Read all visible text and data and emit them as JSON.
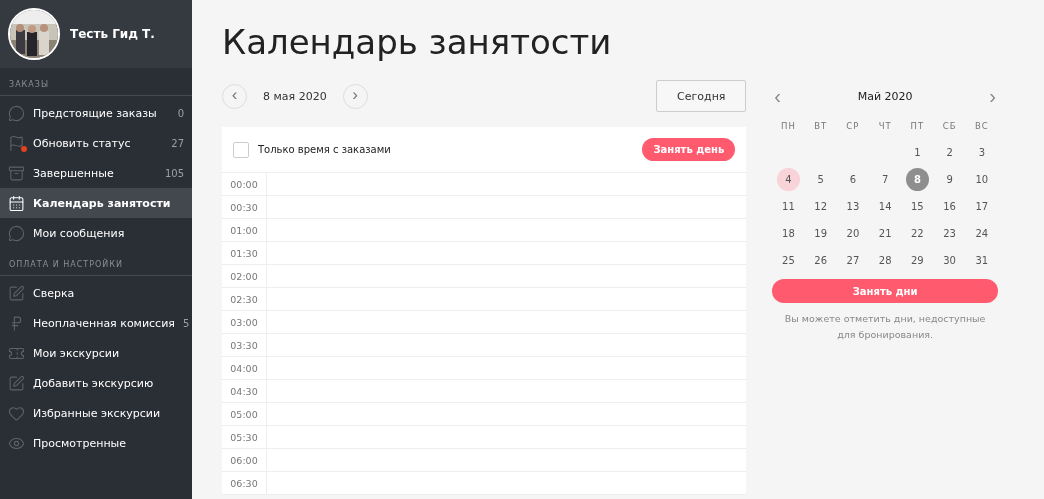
{
  "user": {
    "name": "Тесть Гид Т."
  },
  "sidebar": {
    "sections": [
      {
        "title": "ЗАКАЗЫ",
        "items": [
          {
            "label": "Предстоящие заказы",
            "count": "0",
            "selected": false,
            "alert": false
          },
          {
            "label": "Обновить статус",
            "count": "27",
            "selected": false,
            "alert": true
          },
          {
            "label": "Завершенные",
            "count": "105",
            "selected": false,
            "alert": false
          },
          {
            "label": "Календарь занятости",
            "selected": true,
            "alert": false
          },
          {
            "label": "Мои сообщения",
            "selected": false,
            "alert": false
          }
        ]
      },
      {
        "title": "ОПЛАТА И НАСТРОЙКИ",
        "items": [
          {
            "label": "Сверка",
            "selected": false,
            "alert": false
          },
          {
            "label": "Неоплаченная комиссия",
            "count": "5",
            "selected": false,
            "alert": false
          },
          {
            "label": "Мои экскурсии",
            "selected": false,
            "alert": false
          },
          {
            "label": "Добавить экскурсию",
            "selected": false,
            "alert": false
          },
          {
            "label": "Избранные экскурсии",
            "selected": false,
            "alert": false
          },
          {
            "label": "Просмотренные",
            "selected": false,
            "alert": false
          }
        ]
      }
    ]
  },
  "page": {
    "title": "Календарь занятости"
  },
  "day_nav": {
    "prev": "‹",
    "date": "8 мая 2020",
    "next": "›",
    "today_button": "Сегодня"
  },
  "schedule": {
    "filter": {
      "label": "Только время с заказами",
      "checked": false
    },
    "book_day_button": "Занять день",
    "slots": [
      "00:00",
      "00:30",
      "01:00",
      "01:30",
      "02:00",
      "02:30",
      "03:00",
      "03:30",
      "04:00",
      "04:30",
      "05:00",
      "05:30",
      "06:00",
      "06:30"
    ]
  },
  "month": {
    "prev": "‹",
    "title": "Май 2020",
    "next": "›",
    "weekdays": [
      "ПН",
      "ВТ",
      "СР",
      "ЧТ",
      "ПТ",
      "СБ",
      "ВС"
    ],
    "days": [
      {
        "label": "1",
        "selected": false,
        "marked": false
      },
      {
        "label": "2",
        "selected": false,
        "marked": false
      },
      {
        "label": "3",
        "selected": false,
        "marked": false
      },
      {
        "label": "4",
        "selected": false,
        "marked": true
      },
      {
        "label": "5",
        "selected": false,
        "marked": false
      },
      {
        "label": "6",
        "selected": false,
        "marked": false
      },
      {
        "label": "7",
        "selected": false,
        "marked": false
      },
      {
        "label": "8",
        "selected": true,
        "marked": false
      },
      {
        "label": "9",
        "selected": false,
        "marked": false
      },
      {
        "label": "10",
        "selected": false,
        "marked": false
      },
      {
        "label": "11",
        "selected": false,
        "marked": false
      },
      {
        "label": "12",
        "selected": false,
        "marked": false
      },
      {
        "label": "13",
        "selected": false,
        "marked": false
      },
      {
        "label": "14",
        "selected": false,
        "marked": false
      },
      {
        "label": "15",
        "selected": false,
        "marked": false
      },
      {
        "label": "16",
        "selected": false,
        "marked": false
      },
      {
        "label": "17",
        "selected": false,
        "marked": false
      },
      {
        "label": "18",
        "selected": false,
        "marked": false
      },
      {
        "label": "19",
        "selected": false,
        "marked": false
      },
      {
        "label": "20",
        "selected": false,
        "marked": false
      },
      {
        "label": "21",
        "selected": false,
        "marked": false
      },
      {
        "label": "22",
        "selected": false,
        "marked": false
      },
      {
        "label": "23",
        "selected": false,
        "marked": false
      },
      {
        "label": "24",
        "selected": false,
        "marked": false
      },
      {
        "label": "25",
        "selected": false,
        "marked": false
      },
      {
        "label": "26",
        "selected": false,
        "marked": false
      },
      {
        "label": "27",
        "selected": false,
        "marked": false
      },
      {
        "label": "28",
        "selected": false,
        "marked": false
      },
      {
        "label": "29",
        "selected": false,
        "marked": false
      },
      {
        "label": "30",
        "selected": false,
        "marked": false
      },
      {
        "label": "31",
        "selected": false,
        "marked": false
      }
    ],
    "book_days_button": "Занять дни",
    "note": "Вы можете отметить дни, недоступные для бронирования."
  }
}
